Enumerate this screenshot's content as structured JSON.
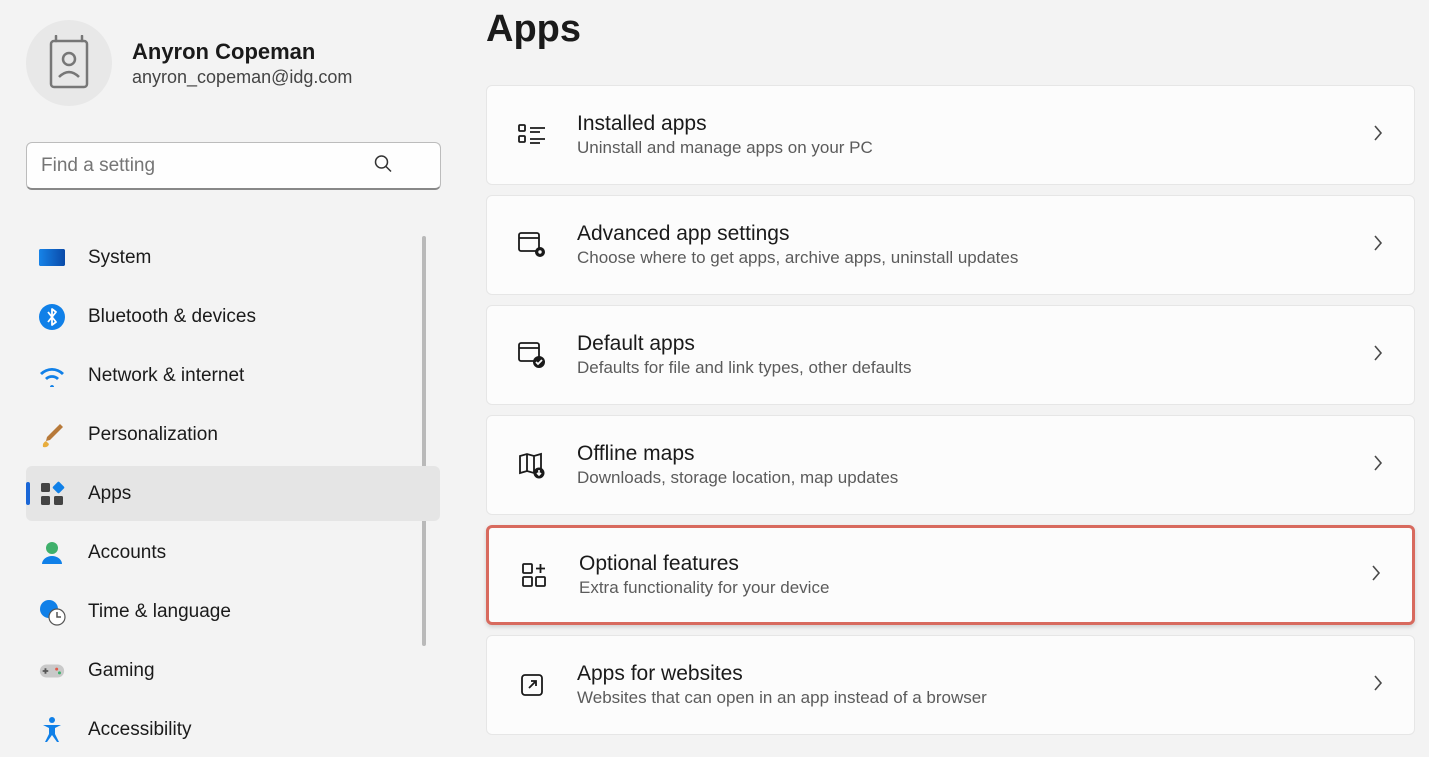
{
  "profile": {
    "name": "Anyron Copeman",
    "email": "anyron_copeman@idg.com"
  },
  "search": {
    "placeholder": "Find a setting"
  },
  "nav": [
    {
      "id": "system",
      "label": "System",
      "selected": false
    },
    {
      "id": "bluetooth",
      "label": "Bluetooth & devices",
      "selected": false
    },
    {
      "id": "network",
      "label": "Network & internet",
      "selected": false
    },
    {
      "id": "personalization",
      "label": "Personalization",
      "selected": false
    },
    {
      "id": "apps",
      "label": "Apps",
      "selected": true
    },
    {
      "id": "accounts",
      "label": "Accounts",
      "selected": false
    },
    {
      "id": "time",
      "label": "Time & language",
      "selected": false
    },
    {
      "id": "gaming",
      "label": "Gaming",
      "selected": false
    },
    {
      "id": "accessibility",
      "label": "Accessibility",
      "selected": false
    }
  ],
  "page": {
    "title": "Apps"
  },
  "cards": [
    {
      "id": "installed-apps",
      "title": "Installed apps",
      "desc": "Uninstall and manage apps on your PC",
      "highlight": false
    },
    {
      "id": "advanced-settings",
      "title": "Advanced app settings",
      "desc": "Choose where to get apps, archive apps, uninstall updates",
      "highlight": false
    },
    {
      "id": "default-apps",
      "title": "Default apps",
      "desc": "Defaults for file and link types, other defaults",
      "highlight": false
    },
    {
      "id": "offline-maps",
      "title": "Offline maps",
      "desc": "Downloads, storage location, map updates",
      "highlight": false
    },
    {
      "id": "optional-features",
      "title": "Optional features",
      "desc": "Extra functionality for your device",
      "highlight": true
    },
    {
      "id": "apps-for-websites",
      "title": "Apps for websites",
      "desc": "Websites that can open in an app instead of a browser",
      "highlight": false
    }
  ]
}
